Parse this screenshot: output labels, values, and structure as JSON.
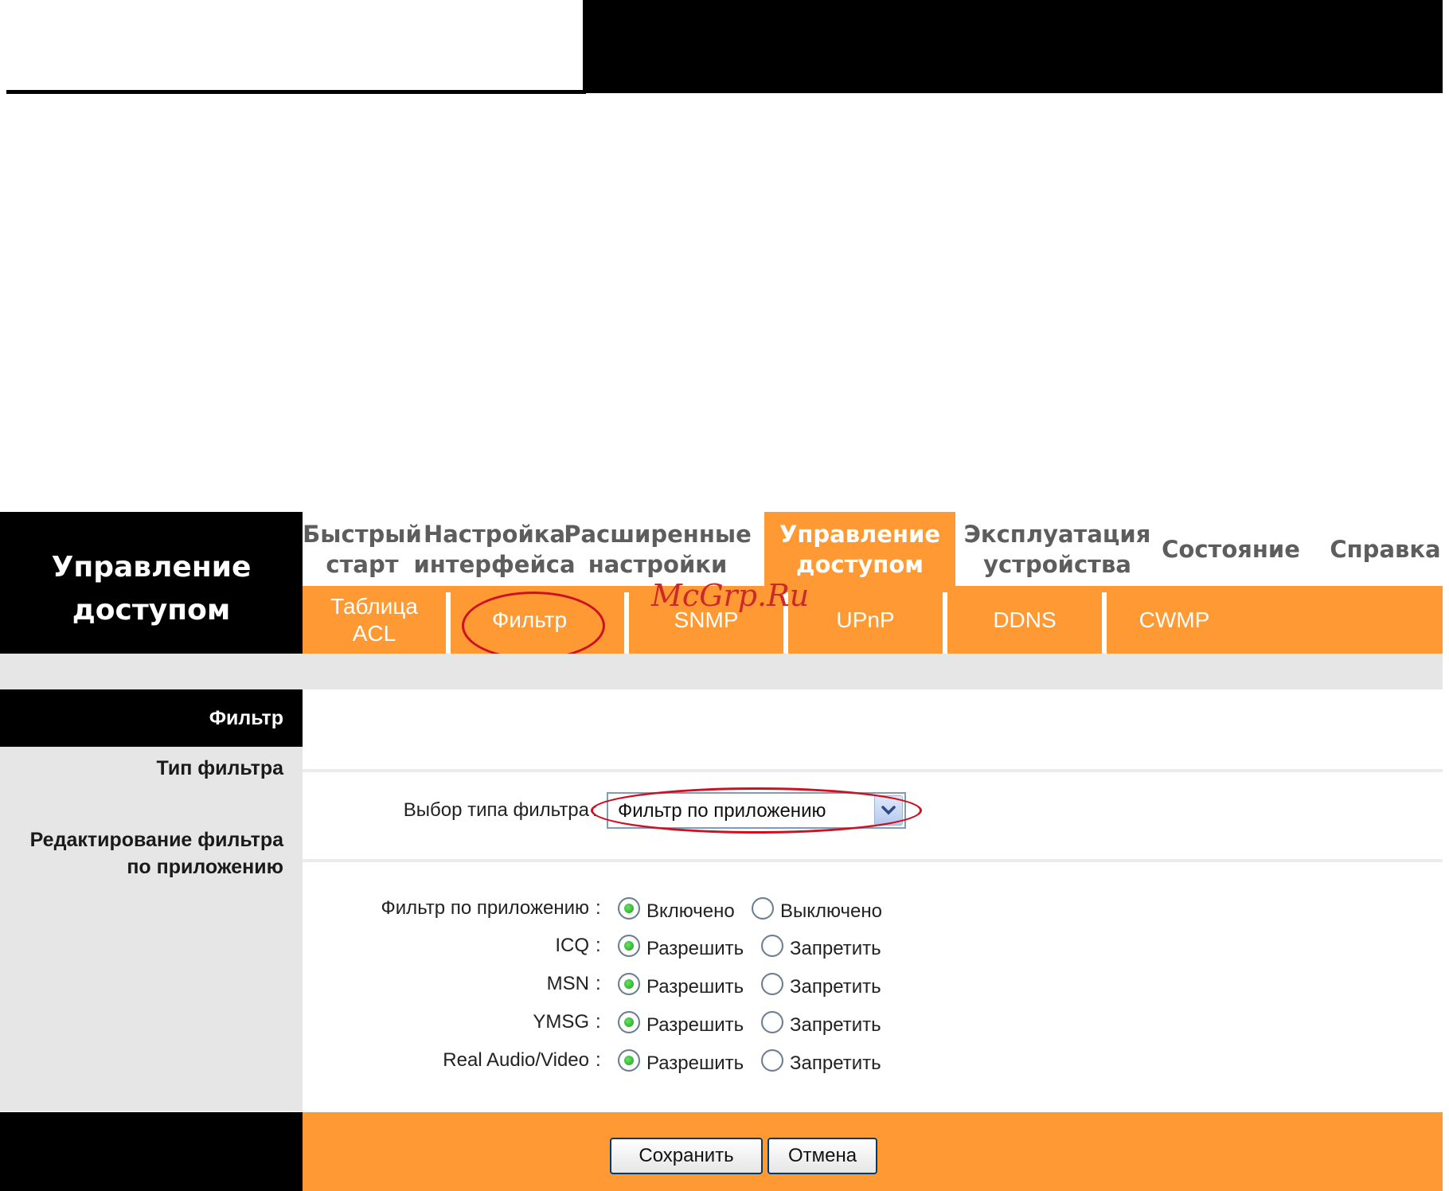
{
  "brand": {
    "line1": "Управление",
    "line2": "доступом"
  },
  "main_tabs": [
    {
      "line1": "Быстрый",
      "line2": "старт"
    },
    {
      "line1": "Настройка",
      "line2": "интерфейса"
    },
    {
      "line1": "Расширенные",
      "line2": "настройки"
    },
    {
      "line1": "Управление",
      "line2": "доступом",
      "active": true
    },
    {
      "line1": "Эксплуатация",
      "line2": "устройства"
    },
    {
      "line1": "Состояние",
      "line2": ""
    },
    {
      "line1": "Справка",
      "line2": ""
    }
  ],
  "sub_tabs": [
    {
      "line1": "Таблица",
      "line2": "ACL"
    },
    {
      "line1": "Фильтр",
      "line2": "",
      "active": true
    },
    {
      "line1": "SNMP",
      "line2": ""
    },
    {
      "line1": "UPnP",
      "line2": ""
    },
    {
      "line1": "DDNS",
      "line2": ""
    },
    {
      "line1": "CWMP",
      "line2": ""
    }
  ],
  "sidebar": {
    "title": "Фильтр",
    "section_type": "Тип фильтра",
    "section_edit_line1": "Редактирование фильтра",
    "section_edit_line2": "по приложению"
  },
  "filter_type": {
    "label": "Выбор типа фильтра",
    "colon": ":",
    "selected": "Фильтр по приложению"
  },
  "app_filter": {
    "rows": [
      {
        "label": "Фильтр по приложению",
        "colon": ":",
        "option_on": "Включено",
        "option_off": "Выключено",
        "selected": "on"
      },
      {
        "label": "ICQ",
        "colon": ":",
        "option_on": "Разрешить",
        "option_off": "Запретить",
        "selected": "on"
      },
      {
        "label": "MSN",
        "colon": ":",
        "option_on": "Разрешить",
        "option_off": "Запретить",
        "selected": "on"
      },
      {
        "label": "YMSG",
        "colon": ":",
        "option_on": "Разрешить",
        "option_off": "Запретить",
        "selected": "on"
      },
      {
        "label": "Real Audio/Video",
        "colon": ":",
        "option_on": "Разрешить",
        "option_off": "Запретить",
        "selected": "on"
      }
    ]
  },
  "buttons": {
    "save": "Сохранить",
    "cancel": "Отмена"
  },
  "watermark": "McGrp.Ru",
  "colors": {
    "accent": "#ff9933",
    "header": "#000000",
    "band": "#e6e6e6",
    "highlight": "#cc1122"
  },
  "icons": {
    "select_arrow": "chevron-down-icon"
  }
}
